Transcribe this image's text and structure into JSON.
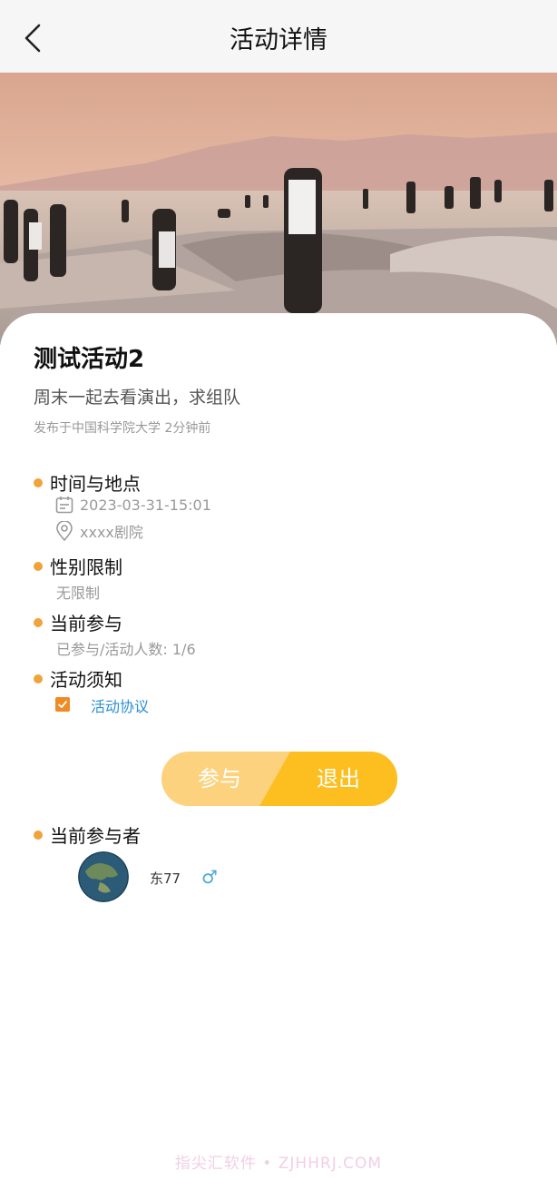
{
  "nav": {
    "title": "活动详情"
  },
  "activity": {
    "title": "测试活动2",
    "subtitle": "周末一起去看演出，求组队",
    "meta": "发布于中国科学院大学 2分钟前"
  },
  "sections": {
    "time_place": {
      "title": "时间与地点",
      "datetime": "2023-03-31-15:01",
      "location": "xxxx剧院"
    },
    "gender": {
      "title": "性别限制",
      "value": "无限制"
    },
    "participation": {
      "title": "当前参与",
      "value": "已参与/活动人数: 1/6"
    },
    "notice": {
      "title": "活动须知",
      "link": "活动协议",
      "checked": true
    },
    "participants": {
      "title": "当前参与者"
    }
  },
  "actions": {
    "join": "参与",
    "quit": "退出"
  },
  "participants": [
    {
      "name": "东77",
      "gender_icon": "♂"
    }
  ],
  "watermark": "指尖汇软件 • ZJHHRJ.COM",
  "colors": {
    "accent": "#f0a33a",
    "checkbox": "#f08a24",
    "join_bg": "#fcd27e",
    "quit_bg": "#fcbf1f",
    "link": "#2a8fd6",
    "male": "#4aa8d8"
  },
  "icons": {
    "back": "chevron-left-icon",
    "calendar": "calendar-icon",
    "location": "location-pin-icon",
    "check": "check-icon",
    "male": "male-icon"
  }
}
